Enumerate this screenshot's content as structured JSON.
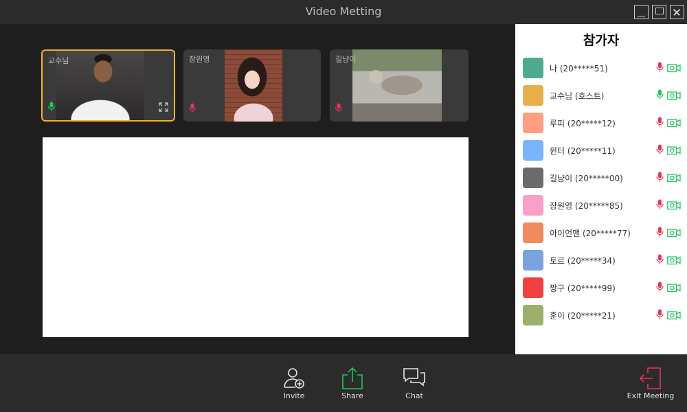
{
  "window": {
    "title": "Video Metting"
  },
  "tiles": [
    {
      "name": "교수님",
      "mic": "on",
      "active": true
    },
    {
      "name": "장원영",
      "mic": "off",
      "active": false
    },
    {
      "name": "길냥이",
      "mic": "off",
      "active": false
    }
  ],
  "panel": {
    "title": "참가자",
    "participants": [
      {
        "name": "나 (20*****51)",
        "color": "#4daa8e",
        "mic": "off"
      },
      {
        "name": "교수님  (호스트)",
        "color": "#e8b04a",
        "mic": "on"
      },
      {
        "name": "루피 (20*****12)",
        "color": "#ff9e80",
        "mic": "off"
      },
      {
        "name": "윈터 (20*****11)",
        "color": "#7ab3ff",
        "mic": "off"
      },
      {
        "name": " 길냥이 (20*****00)",
        "color": "#6b6b6b",
        "mic": "off"
      },
      {
        "name": "장원영 (20*****85)",
        "color": "#f7a0c8",
        "mic": "off"
      },
      {
        "name": "아이언맨 (20*****77)",
        "color": "#f08a5d",
        "mic": "off"
      },
      {
        "name": "토르 (20*****34)",
        "color": "#7aa3e0",
        "mic": "off"
      },
      {
        "name": "짱구 (20*****99)",
        "color": "#f04040",
        "mic": "off"
      },
      {
        "name": "훈이 (20*****21)",
        "color": "#9bb06a",
        "mic": "off"
      }
    ]
  },
  "toolbar": {
    "invite_label": "Invite",
    "share_label": "Share",
    "chat_label": "Chat",
    "exit_label": "Exit Meeting"
  },
  "colors": {
    "mic_on": "#22c55e",
    "mic_off": "#e8335c",
    "camera": "#22c55e",
    "active_border": "#f2b233",
    "exit_accent": "#e8335c"
  }
}
